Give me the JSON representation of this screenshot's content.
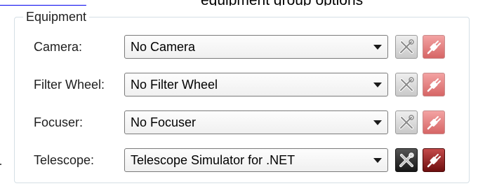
{
  "top": {
    "link_fragment": "_____________",
    "text_fragment": "equipment group options"
  },
  "equipment": {
    "title": "Equipment",
    "rows": [
      {
        "label": "Camera:",
        "value": "No Camera",
        "connected": false
      },
      {
        "label": "Filter Wheel:",
        "value": "No Filter Wheel",
        "connected": false
      },
      {
        "label": "Focuser:",
        "value": "No Focuser",
        "connected": false
      },
      {
        "label": "Telescope:",
        "value": "Telescope Simulator for .NET",
        "connected": true
      }
    ]
  },
  "colors": {
    "groupbox_border": "#d5dfe5",
    "connect_inactive": "#e98a8a",
    "connect_active": "#8c1414",
    "setup_active": "#222222"
  },
  "icons": {
    "setup": "tools-icon",
    "connect": "plug-icon",
    "dropdown": "dropdown-arrow-icon"
  }
}
